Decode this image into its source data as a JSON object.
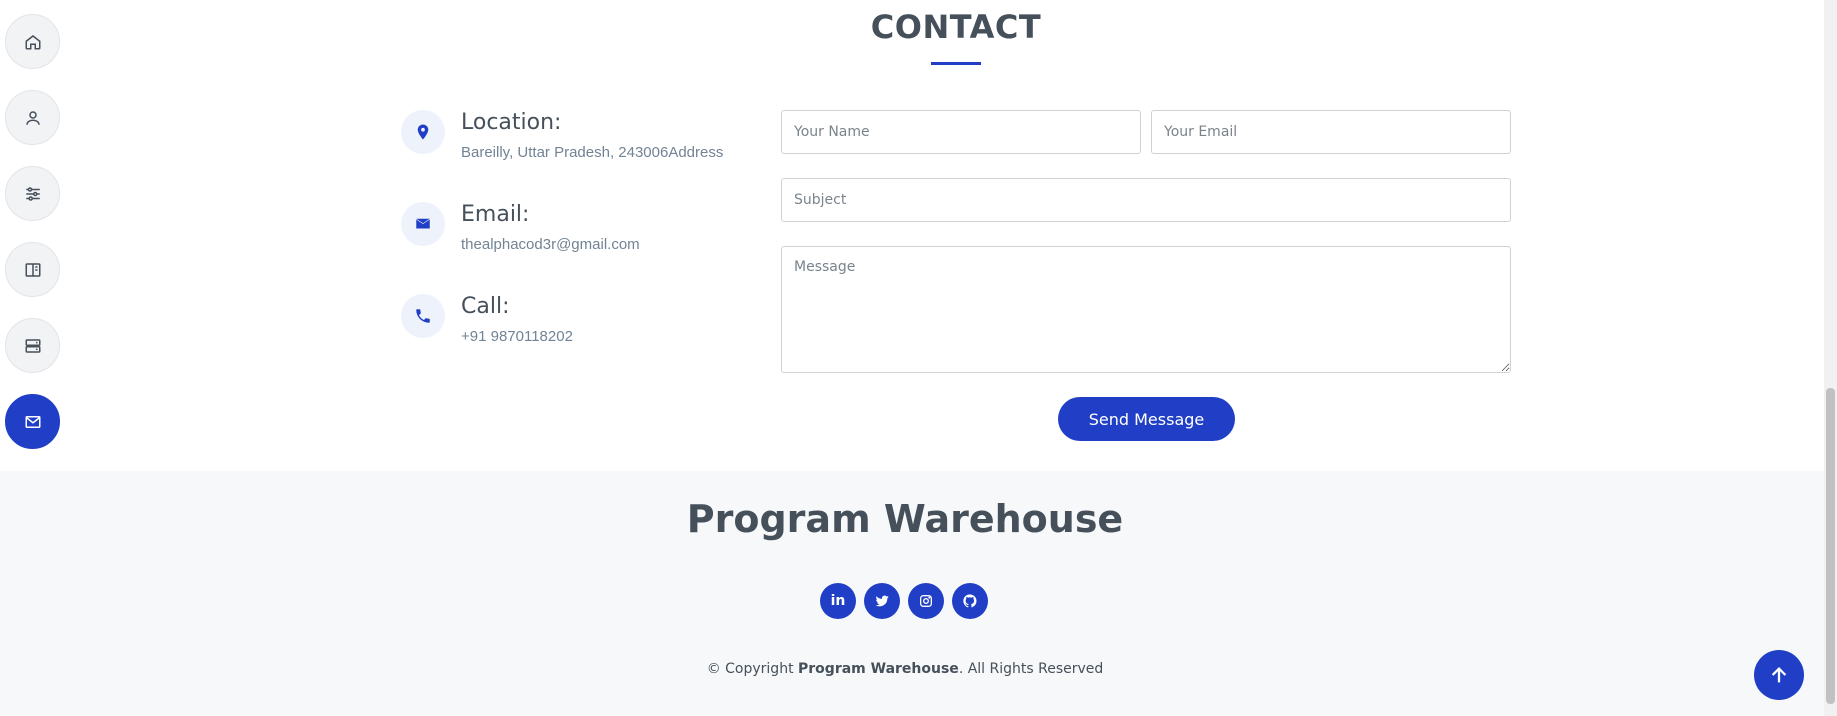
{
  "nav": {
    "items": [
      {
        "icon": "home-icon"
      },
      {
        "icon": "user-icon"
      },
      {
        "icon": "sliders-icon"
      },
      {
        "icon": "book-icon"
      },
      {
        "icon": "server-icon"
      },
      {
        "icon": "envelope-icon",
        "active": true
      }
    ]
  },
  "contact": {
    "title": "CONTACT",
    "location_label": "Location:",
    "location_value": "Bareilly, Uttar Pradesh, 243006Address",
    "email_label": "Email:",
    "email_value": "thealphacod3r@gmail.com",
    "call_label": "Call:",
    "call_value": "+91 9870118202"
  },
  "form": {
    "name_placeholder": "Your Name",
    "email_placeholder": "Your Email",
    "subject_placeholder": "Subject",
    "message_placeholder": "Message",
    "send_label": "Send Message"
  },
  "footer": {
    "brand": "Program Warehouse",
    "copyright_prefix": "© Copyright ",
    "copyright_brand": "Program Warehouse",
    "copyright_suffix": ". All Rights Reserved",
    "socials": [
      "linkedin-icon",
      "twitter-icon",
      "instagram-icon",
      "github-icon"
    ],
    "linkedin_text": "in"
  },
  "colors": {
    "accent": "#203fc6",
    "text": "#45505b",
    "muted": "#728394"
  }
}
